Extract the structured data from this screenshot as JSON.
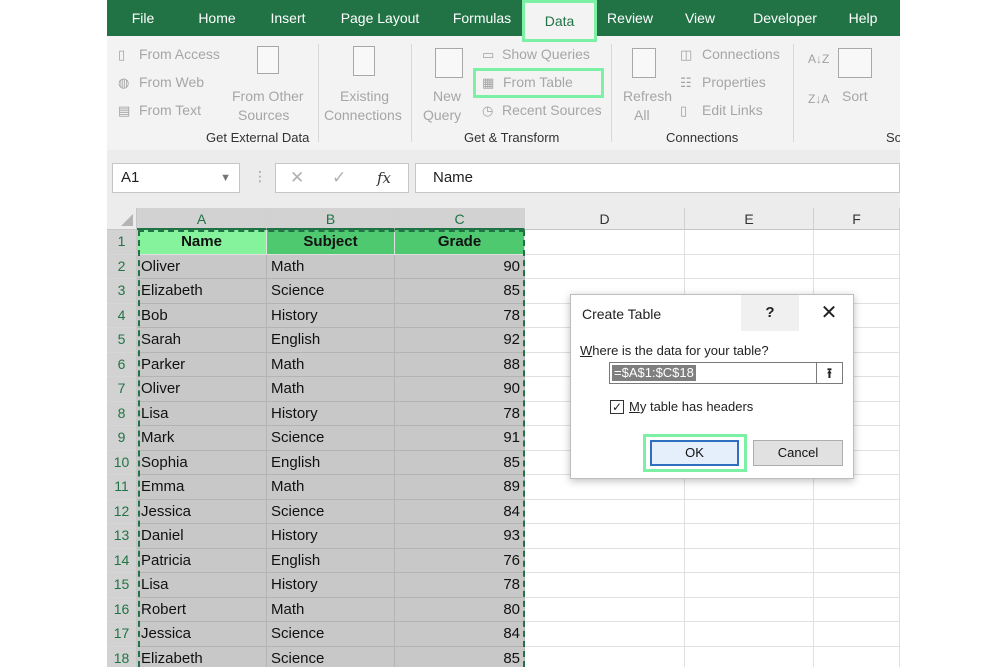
{
  "ribbon_tabs": [
    "File",
    "Home",
    "Insert",
    "Page Layout",
    "Formulas",
    "Data",
    "Review",
    "View",
    "Developer",
    "Help"
  ],
  "active_tab": "Data",
  "get_external_data": {
    "from_access": "From Access",
    "from_web": "From Web",
    "from_text": "From Text",
    "from_other_line1": "From Other",
    "from_other_line2": "Sources",
    "existing_line1": "Existing",
    "existing_line2": "Connections",
    "label": "Get External Data"
  },
  "get_transform": {
    "new_line1": "New",
    "new_line2": "Query",
    "show_queries": "Show Queries",
    "from_table": "From Table",
    "recent_sources": "Recent Sources",
    "label": "Get & Transform"
  },
  "connections": {
    "refresh_line1": "Refresh",
    "refresh_line2": "All",
    "connections": "Connections",
    "properties": "Properties",
    "edit_links": "Edit Links",
    "label": "Connections"
  },
  "sort_filter": {
    "sort": "Sort",
    "label_partial": "So"
  },
  "formula_bar": {
    "name_box": "A1",
    "cancel_symbol": "✕",
    "enter_symbol": "✓",
    "fx_symbol": "fx",
    "value": "Name"
  },
  "columns": [
    "A",
    "B",
    "C",
    "D",
    "E",
    "F"
  ],
  "headers": {
    "name": "Name",
    "subject": "Subject",
    "grade": "Grade"
  },
  "rows": [
    {
      "n": "2",
      "name": "Oliver",
      "subject": "Math",
      "grade": "90"
    },
    {
      "n": "3",
      "name": "Elizabeth",
      "subject": "Science",
      "grade": "85"
    },
    {
      "n": "4",
      "name": "Bob",
      "subject": "History",
      "grade": "78"
    },
    {
      "n": "5",
      "name": "Sarah",
      "subject": "English",
      "grade": "92"
    },
    {
      "n": "6",
      "name": "Parker",
      "subject": "Math",
      "grade": "88"
    },
    {
      "n": "7",
      "name": "Oliver",
      "subject": "Math",
      "grade": "90"
    },
    {
      "n": "8",
      "name": "Lisa",
      "subject": "History",
      "grade": "78"
    },
    {
      "n": "9",
      "name": "Mark",
      "subject": "Science",
      "grade": "91"
    },
    {
      "n": "10",
      "name": "Sophia",
      "subject": "English",
      "grade": "85"
    },
    {
      "n": "11",
      "name": "Emma",
      "subject": "Math",
      "grade": "89"
    },
    {
      "n": "12",
      "name": "Jessica",
      "subject": "Science",
      "grade": "84"
    },
    {
      "n": "13",
      "name": "Daniel",
      "subject": "History",
      "grade": "93"
    },
    {
      "n": "14",
      "name": "Patricia",
      "subject": "English",
      "grade": "76"
    },
    {
      "n": "15",
      "name": "Lisa",
      "subject": "History",
      "grade": "78"
    },
    {
      "n": "16",
      "name": "Robert",
      "subject": "Math",
      "grade": "80"
    },
    {
      "n": "17",
      "name": "Jessica",
      "subject": "Science",
      "grade": "84"
    },
    {
      "n": "18",
      "name": "Elizabeth",
      "subject": "Science",
      "grade": "85"
    }
  ],
  "dialog": {
    "title": "Create Table",
    "help": "?",
    "close": "✕",
    "prompt": "Where is the data for your table?",
    "range": "=$A$1:$C$18",
    "collapse_symbol": "⭱",
    "checkbox_label": "My table has headers",
    "checkbox_checked": true,
    "checkbox_mark": "✓",
    "ok": "OK",
    "cancel": "Cancel"
  }
}
